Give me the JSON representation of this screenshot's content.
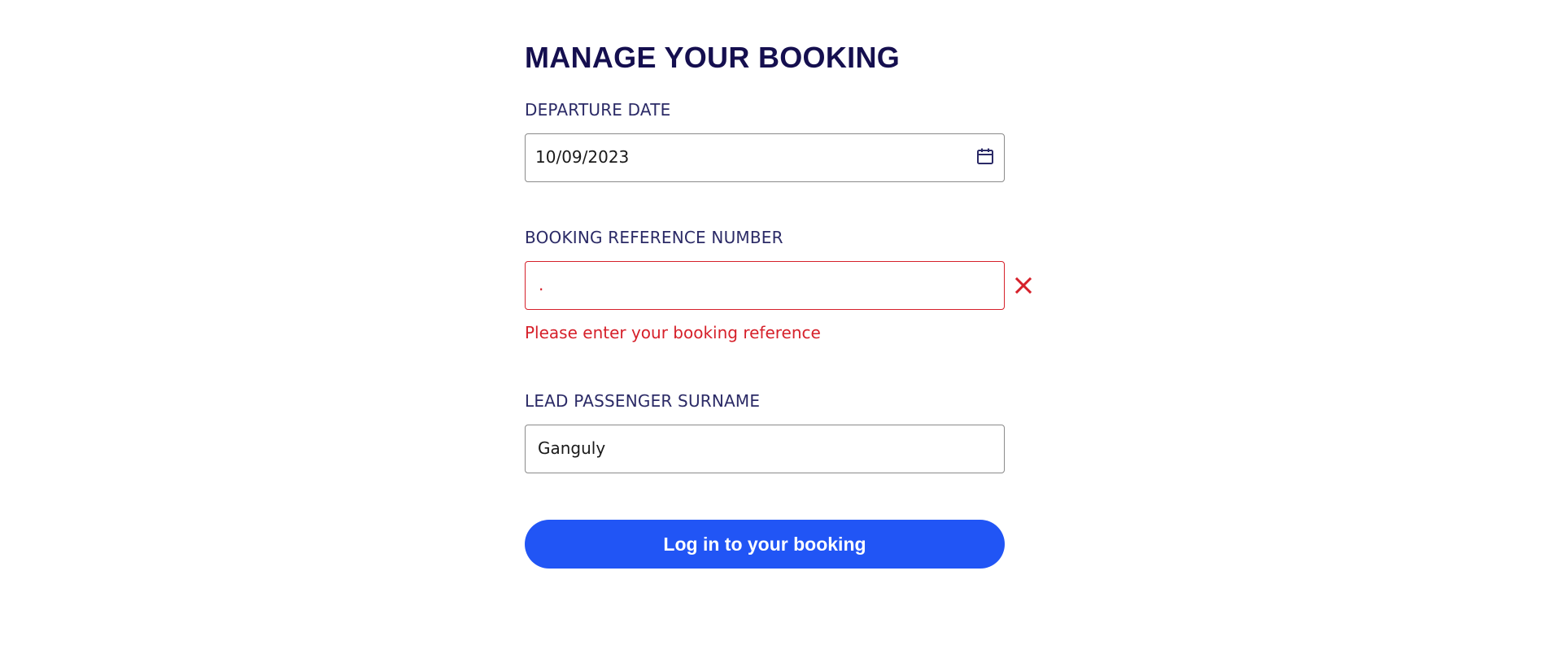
{
  "page": {
    "title": "MANAGE YOUR BOOKING"
  },
  "departure": {
    "label": "DEPARTURE DATE",
    "value": "10/09/2023",
    "icon": "calendar-icon"
  },
  "booking_reference": {
    "label": "BOOKING REFERENCE NUMBER",
    "value": ".",
    "error_icon": "close-icon",
    "error_message": "Please enter your booking reference"
  },
  "surname": {
    "label": "LEAD PASSENGER SURNAME",
    "value": "Ganguly"
  },
  "submit": {
    "label": "Log in to your booking"
  },
  "colors": {
    "heading": "#150f4f",
    "label": "#2b2a66",
    "error": "#d6202a",
    "button": "#2155f5",
    "border": "#8a8a8a"
  }
}
